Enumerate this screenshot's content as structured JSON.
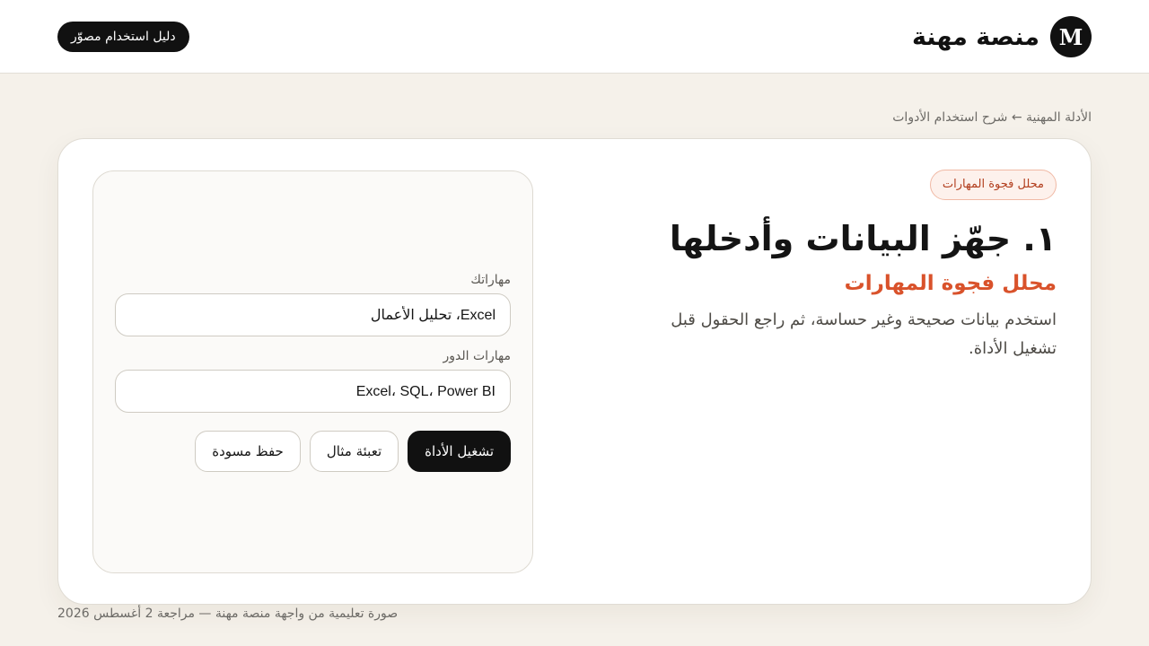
{
  "header": {
    "brand_logo_letter": "M",
    "brand_name": "منصة مهنة",
    "guide_button_label": "دليل استخدام مصوّر"
  },
  "breadcrumb": {
    "text": "الأدلة المهنية ← شرح استخدام الأدوات"
  },
  "intro": {
    "tag_label": "محلل فجوة المهارات",
    "step_title": "١. جهّز البيانات وأدخلها",
    "subtitle": "محلل فجوة المهارات",
    "description": "استخدم بيانات صحيحة وغير حساسة، ثم راجع الحقول قبل تشغيل الأداة."
  },
  "form": {
    "fields": [
      {
        "label": "مهاراتك",
        "value": "Excel، تحليل الأعمال"
      },
      {
        "label": "مهارات الدور",
        "value": "Excel، SQL، Power BI"
      }
    ],
    "actions": {
      "run_label": "تشغيل الأداة",
      "fill_example_label": "تعبئة مثال",
      "save_draft_label": "حفظ مسودة"
    }
  },
  "footer": {
    "caption": "صورة تعليمية من واجهة منصة مهنة — مراجعة 2 أغسطس 2026"
  },
  "colors": {
    "page_background": "#f5f1ea",
    "accent": "#d9522b",
    "tag_text": "#b23f1f",
    "primary_button": "#111111"
  }
}
